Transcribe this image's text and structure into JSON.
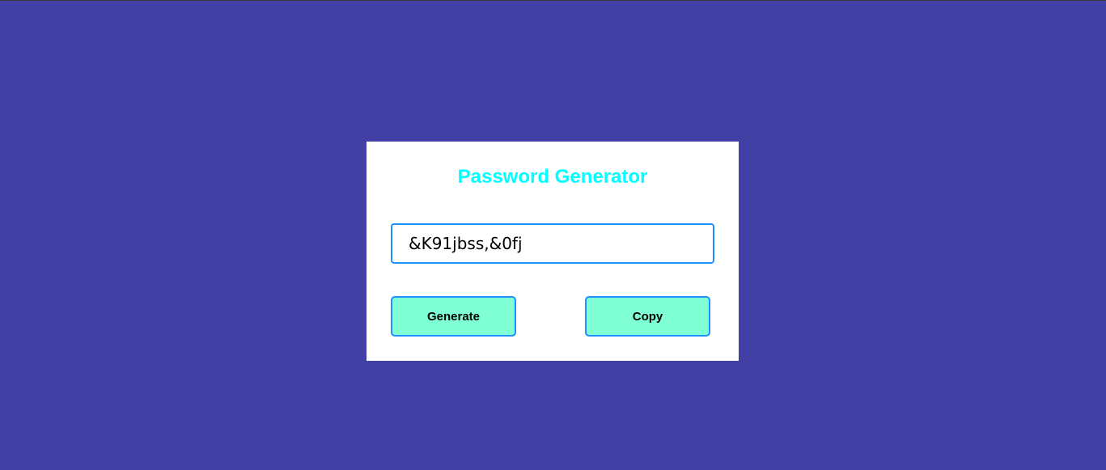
{
  "colors": {
    "background": "#4140a5",
    "card": "#ffffff",
    "title": "#00ffff",
    "button_fill": "#7fffd4",
    "border_accent": "#1e90ff"
  },
  "card": {
    "title": "Password Generator",
    "password_value": "&K91jbss,&0fj",
    "generate_label": "Generate",
    "copy_label": "Copy"
  }
}
